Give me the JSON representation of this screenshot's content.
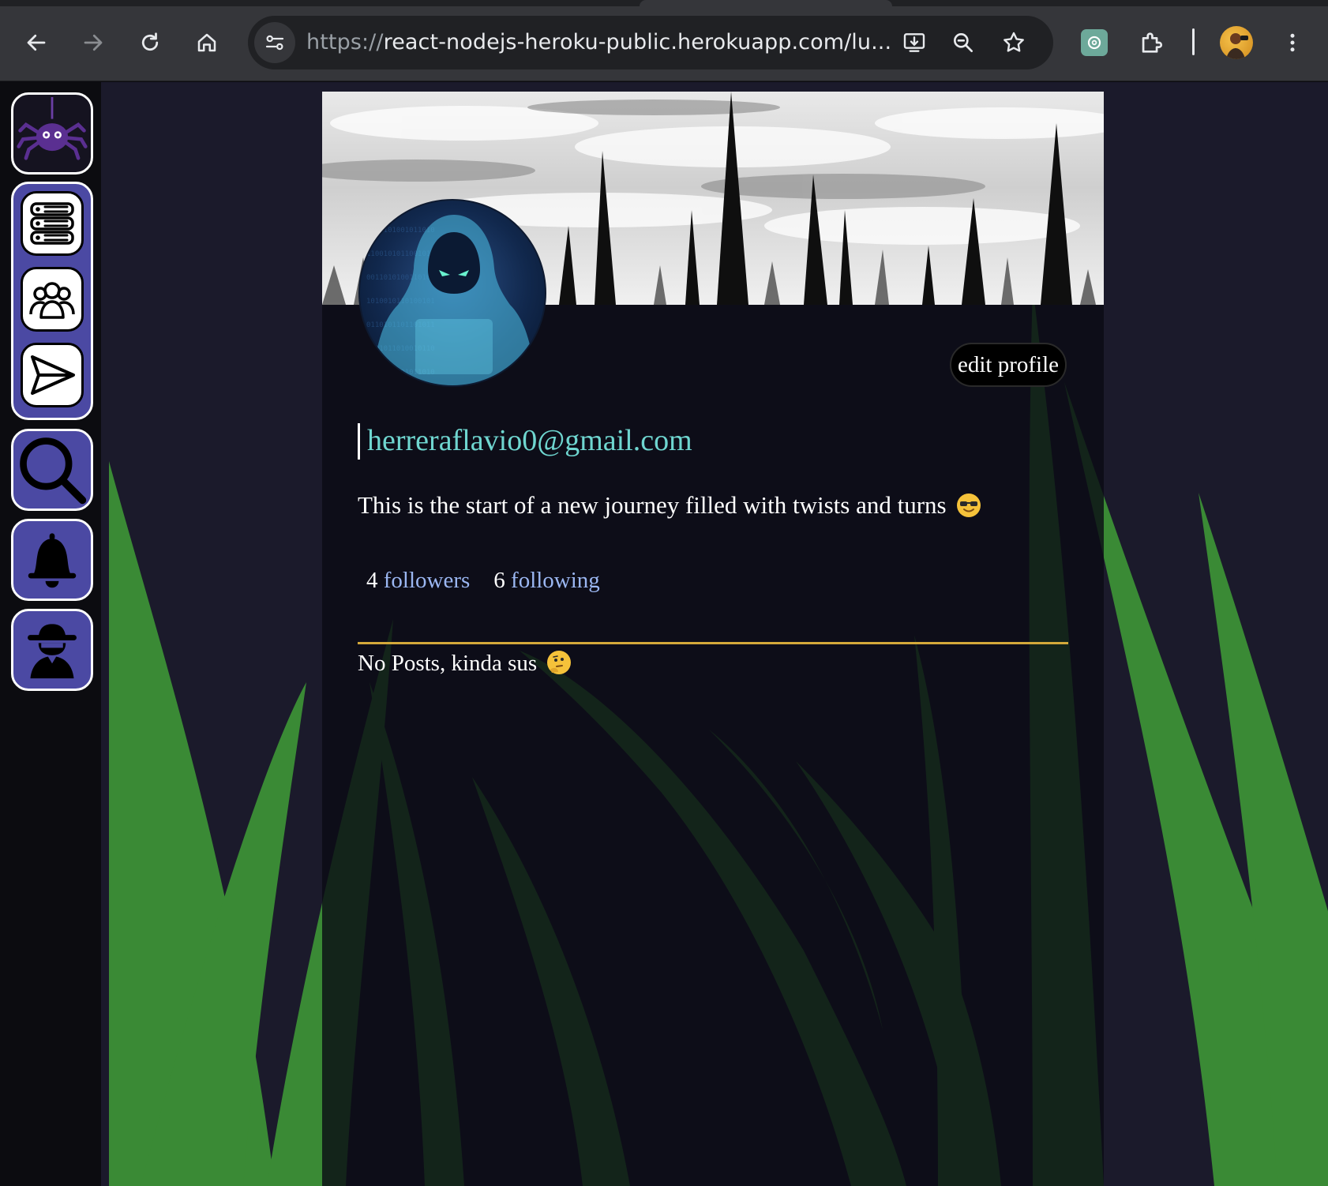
{
  "browser": {
    "url_scheme": "https://",
    "url_host": "react-nodejs-heroku-public.herokuapp.com/lu...",
    "icons": [
      "back-arrow-icon",
      "forward-arrow-icon",
      "reload-icon",
      "home-icon",
      "site-info-icon",
      "install-app-icon",
      "zoom-icon",
      "bookmark-star-icon",
      "chatgpt-extension-icon",
      "extensions-puzzle-icon",
      "profile-avatar-icon",
      "kebab-menu-icon"
    ]
  },
  "sidebar": {
    "items": [
      {
        "name": "spider-logo-icon"
      },
      {
        "name": "server-feed-icon"
      },
      {
        "name": "friends-group-icon"
      },
      {
        "name": "send-message-icon"
      },
      {
        "name": "search-icon"
      },
      {
        "name": "notifications-bell-icon"
      },
      {
        "name": "spy-profile-icon"
      }
    ]
  },
  "profile": {
    "edit_label": "edit profile",
    "username": "herreraflavio0@gmail.com",
    "bio": "This is the start of a new journey filled with twists and turns",
    "followers_count": "4",
    "followers_label": "followers",
    "following_count": "6",
    "following_label": "following",
    "no_posts": "No Posts, kinda sus"
  },
  "colors": {
    "sidebar_tile": "#4b49a3",
    "username": "#6fd6d0",
    "link": "#9bb7f2",
    "divider": "#d4a93a",
    "grass": "#3a8a35"
  }
}
